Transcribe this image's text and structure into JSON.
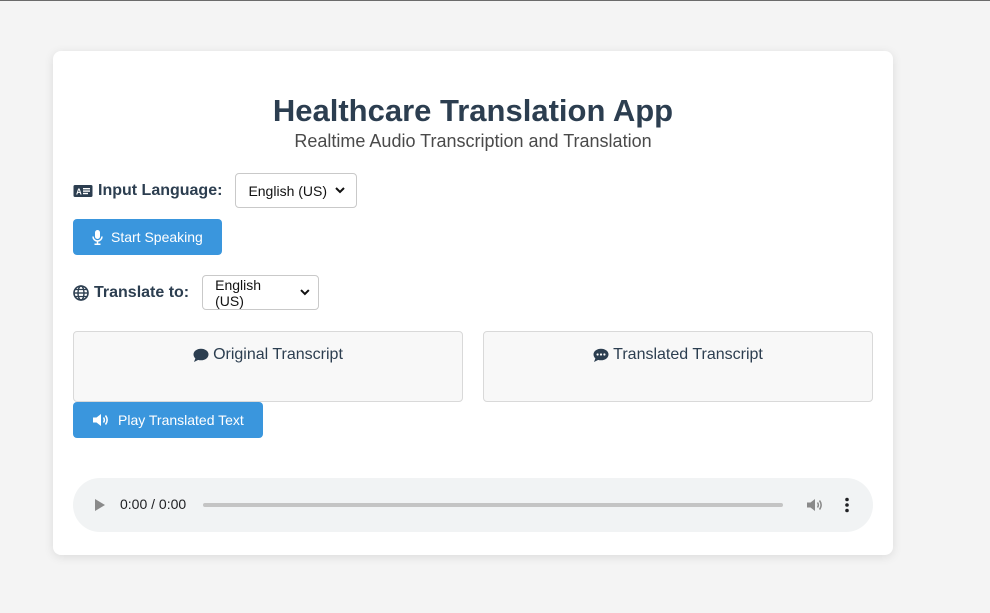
{
  "header": {
    "title": "Healthcare Translation App",
    "subtitle": "Realtime Audio Transcription and Translation"
  },
  "input_language": {
    "label": "Input Language:",
    "icon": "language-card-icon",
    "selected": "English (US)"
  },
  "start_button": {
    "label": "Start Speaking",
    "icon": "microphone-icon"
  },
  "translate_to": {
    "label": "Translate to:",
    "icon": "globe-icon",
    "selected": "English (US)"
  },
  "transcripts": {
    "original": {
      "label": "Original Transcript",
      "icon": "comment-icon"
    },
    "translated": {
      "label": "Translated Transcript",
      "icon": "comment-dots-icon"
    }
  },
  "play_button": {
    "label": "Play Translated Text",
    "icon": "volume-up-icon"
  },
  "audio_player": {
    "time": "0:00 / 0:00",
    "progress": 0
  },
  "colors": {
    "accent": "#3a96dd",
    "text": "#2c3e50",
    "background": "#f4f4f4"
  }
}
